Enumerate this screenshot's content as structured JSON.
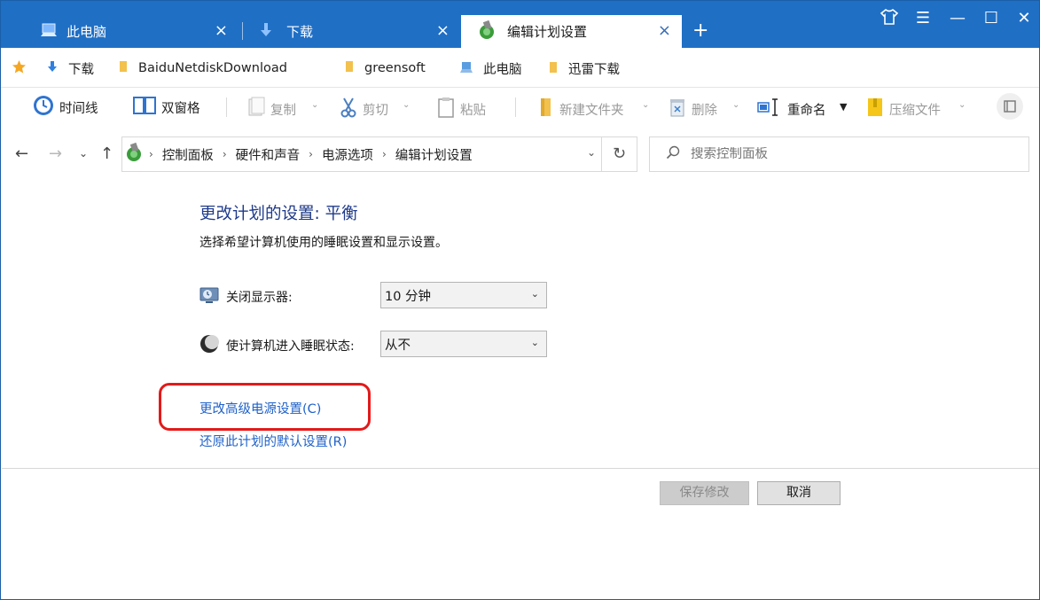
{
  "tabs": [
    {
      "label": "此电脑",
      "icon": "computer-icon",
      "active": false
    },
    {
      "label": "下载",
      "icon": "download-arrow-icon",
      "active": false
    },
    {
      "label": "编辑计划设置",
      "icon": "power-options-icon",
      "active": true
    }
  ],
  "tab_close_symbol": "×",
  "new_tab_symbol": "+",
  "window_controls": {
    "skin": "shirt-icon",
    "menu": "☰",
    "minimize": "—",
    "maximize": "☐",
    "close": "✕"
  },
  "favorites": [
    {
      "label": "下载",
      "icon": "download-arrow-icon"
    },
    {
      "label": "BaiduNetdiskDownload",
      "icon": "folder-icon"
    },
    {
      "label": "greensoft",
      "icon": "folder-icon"
    },
    {
      "label": "此电脑",
      "icon": "computer-icon"
    },
    {
      "label": "迅雷下载",
      "icon": "folder-icon"
    }
  ],
  "toolbar": {
    "timeline": "时间线",
    "dual_pane": "双窗格",
    "copy": "复制",
    "cut": "剪切",
    "paste": "粘贴",
    "new_folder": "新建文件夹",
    "delete": "删除",
    "rename": "重命名",
    "compress": "压缩文件"
  },
  "address": {
    "breadcrumbs": [
      "控制面板",
      "硬件和声音",
      "电源选项",
      "编辑计划设置"
    ],
    "search_placeholder": "搜索控制面板"
  },
  "content": {
    "title": "更改计划的设置: 平衡",
    "subtitle": "选择希望计算机使用的睡眠设置和显示设置。",
    "display_off_label": "关闭显示器:",
    "display_off_value": "10 分钟",
    "sleep_label": "使计算机进入睡眠状态:",
    "sleep_value": "从不",
    "advanced_link": "更改高级电源设置(C)",
    "restore_link": "还原此计划的默认设置(R)"
  },
  "buttons": {
    "save": "保存修改",
    "cancel": "取消"
  },
  "colors": {
    "titlebar": "#1f6fc5",
    "link": "#1f62c9",
    "title_text": "#1e3a8a",
    "highlight": "#e31a1a"
  }
}
